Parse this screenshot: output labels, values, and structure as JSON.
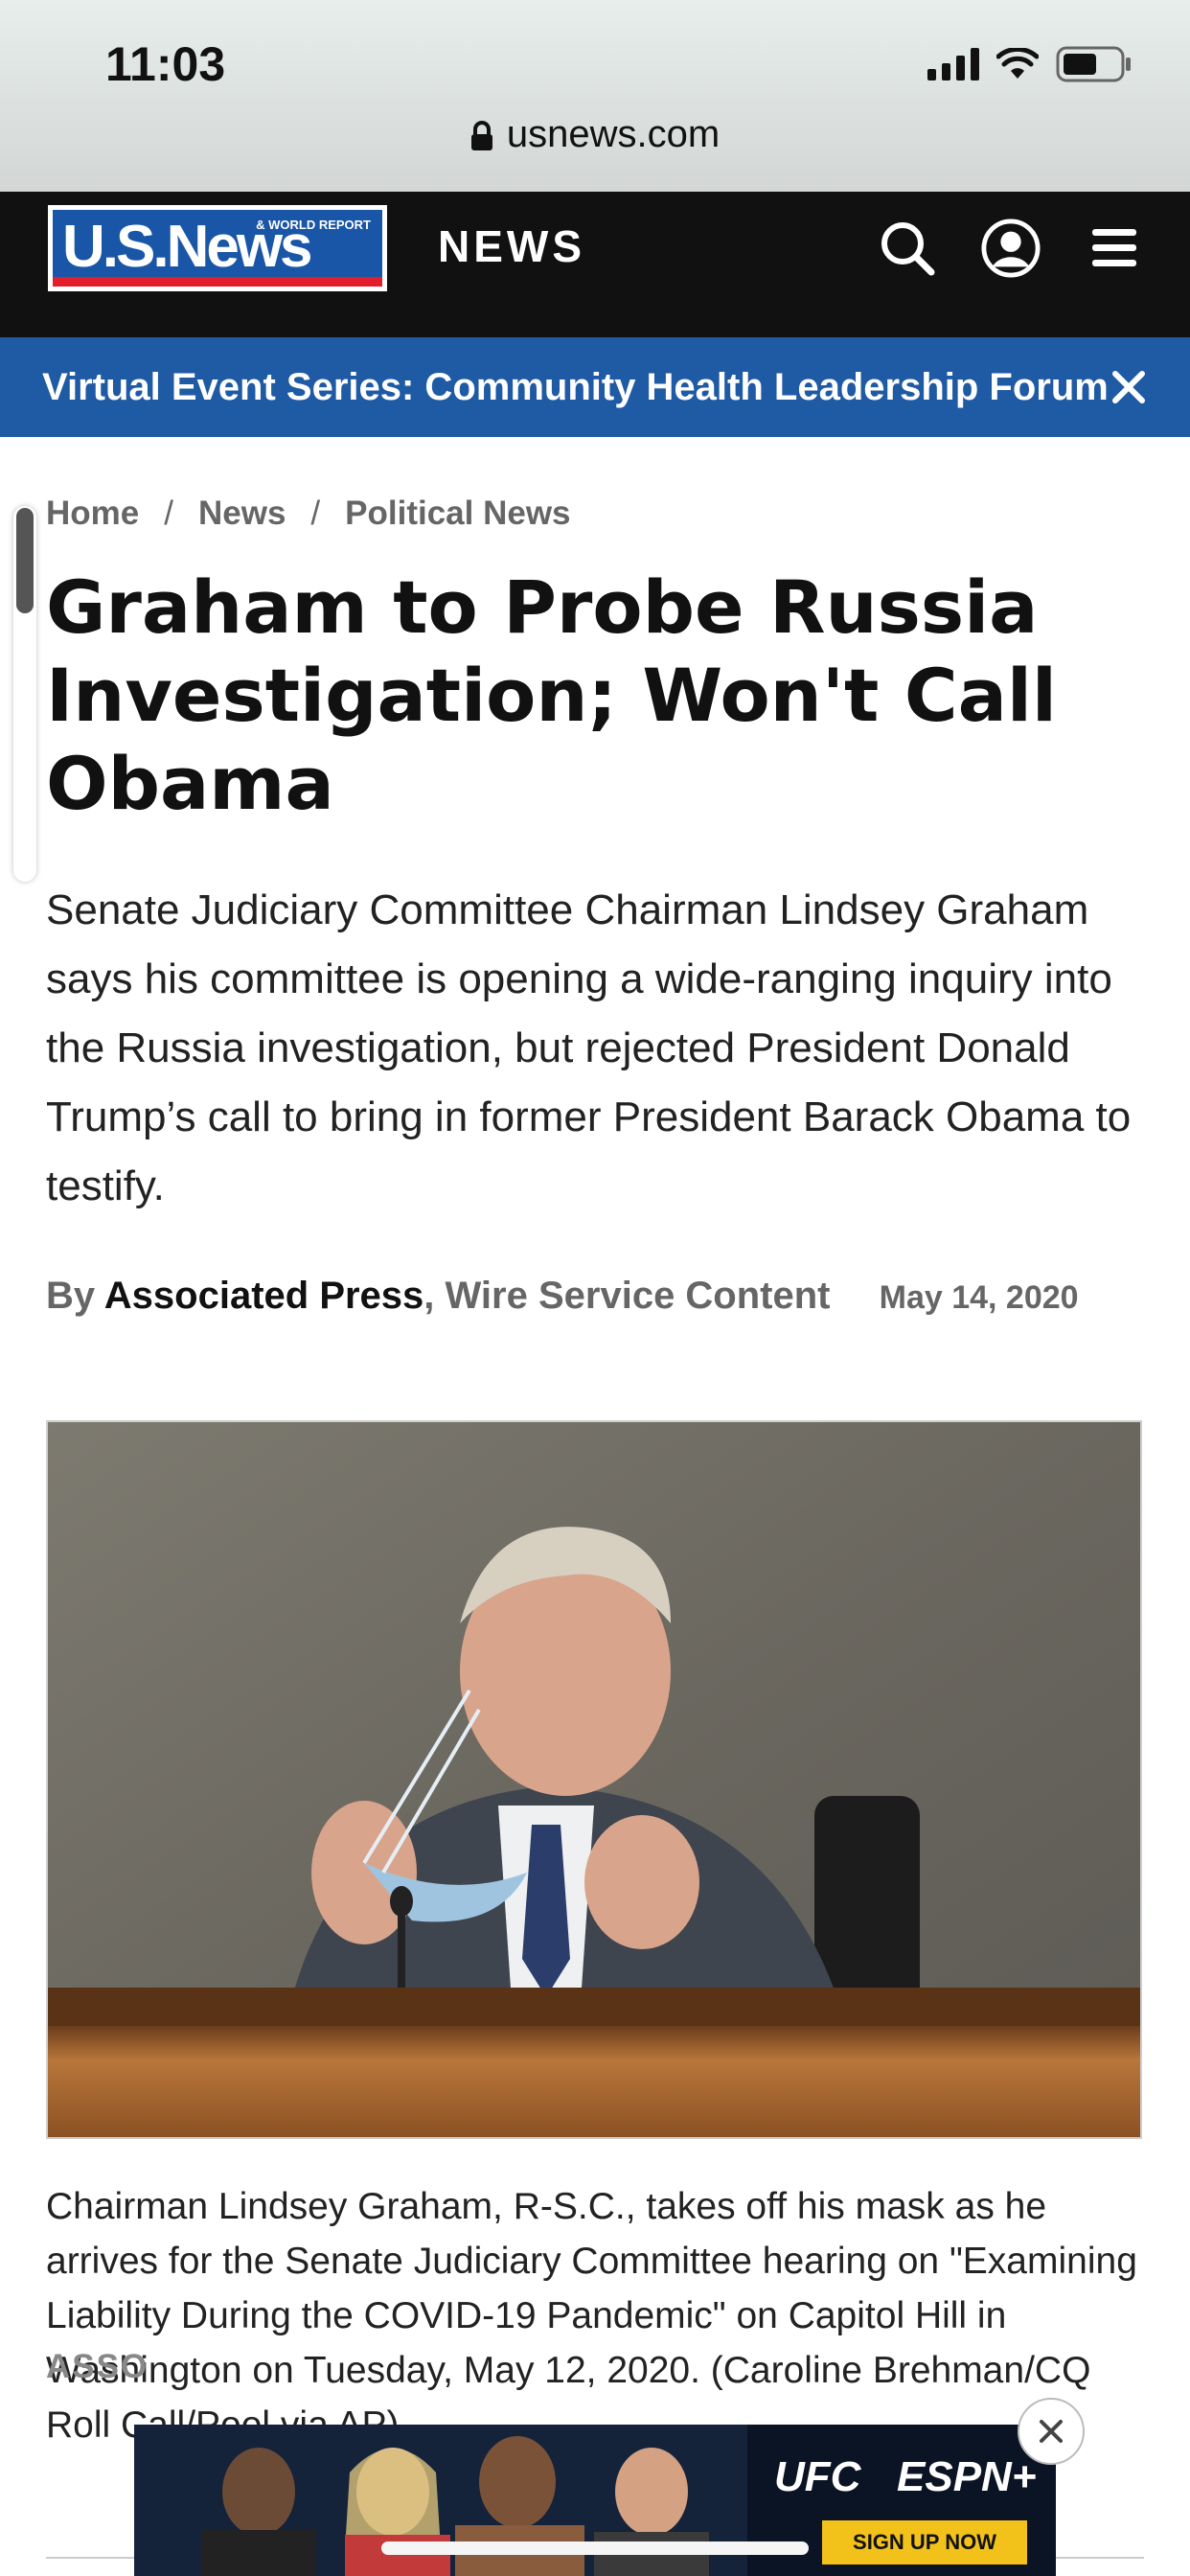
{
  "status": {
    "time": "11:03",
    "url": "usnews.com"
  },
  "header": {
    "logo_text": "U.S.News",
    "logo_sub": "& WORLD REPORT",
    "section": "NEWS",
    "icons": [
      "search-icon",
      "account-icon",
      "menu-icon"
    ]
  },
  "banner": {
    "text": "Virtual Event Series: Community Health Leadership Forum"
  },
  "breadcrumb": {
    "items": [
      "Home",
      "News",
      "Political News"
    ]
  },
  "article": {
    "title": "Graham to Probe Russia Investigation; Won't Call Obama",
    "dek": "Senate Judiciary Committee Chairman Lindsey Graham says his committee is opening a wide-ranging inquiry into the Russia investigation, but rejected President Donald Trump’s call to bring in former President Barack Obama to testify.",
    "byline_prefix": "By",
    "author": "Associated Press",
    "source": ", Wire Service Content",
    "date": "May 14, 2020",
    "caption": "Chairman Lindsey Graham, R-S.C., takes off his mask as he arrives for the Senate Judiciary Committee hearing on \"Examining Liability During the COVID-19 Pandemic\" on Capitol Hill in Washington on Tuesday, May 12, 2020. (Caroline Brehman/CQ Roll Call/Pool via AP)",
    "caption_end": "ASSO"
  },
  "ad": {
    "brand1": "UFC",
    "brand2": "ESPN+",
    "cta": "SIGN UP NOW"
  },
  "colors": {
    "banner_bg": "#1f5aa5",
    "header_bg": "#111111",
    "logo_blue": "#1a56a7",
    "logo_red": "#e21e2c"
  }
}
